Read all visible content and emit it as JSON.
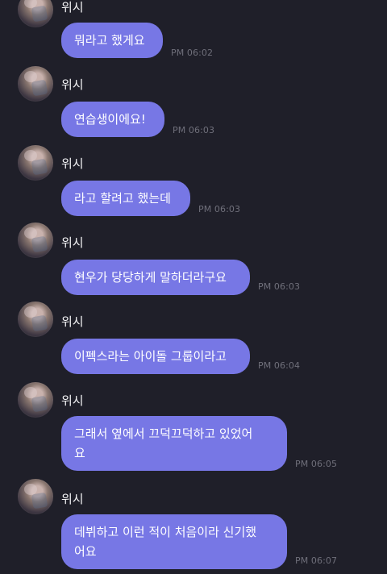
{
  "chat": {
    "messages": [
      {
        "sender": "위시",
        "text": "뭐라고 했게요",
        "time": "PM 06:02"
      },
      {
        "sender": "위시",
        "text": "연습생이에요!",
        "time": "PM 06:03"
      },
      {
        "sender": "위시",
        "text": "라고 할려고 했는데",
        "time": "PM 06:03"
      },
      {
        "sender": "위시",
        "text": "현우가 당당하게 말하더라구요",
        "time": "PM 06:03"
      },
      {
        "sender": "위시",
        "text": "이펙스라는 아이돌 그룹이라고",
        "time": "PM 06:04"
      },
      {
        "sender": "위시",
        "text": "그래서 옆에서 끄덕끄덕하고 있었어\n요",
        "time": "PM 06:05"
      },
      {
        "sender": "위시",
        "text": "데뷔하고 이런 적이 처음이라 신기했\n어요",
        "time": "PM 06:07"
      }
    ]
  },
  "colors": {
    "background": "#1f1f29",
    "bubble": "#7777e5",
    "timestamp": "#6f6f7a",
    "name": "#f4f4f6"
  }
}
